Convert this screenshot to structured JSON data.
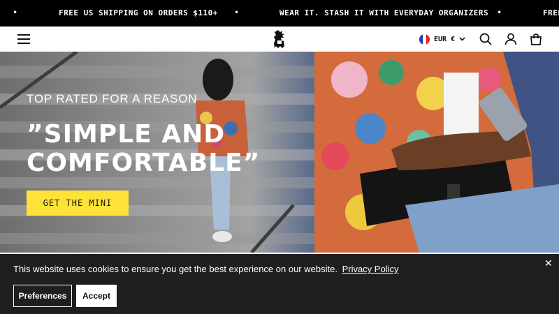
{
  "announcement": {
    "bullet": "•",
    "messages": [
      "FREE US SHIPPING ON ORDERS $110+",
      "WEAR IT. STASH IT WITH EVERYDAY ORGANIZERS",
      "FREE"
    ]
  },
  "header": {
    "menu_icon": "hamburger-menu-icon",
    "logo_icon": "chrome-griffin-logo",
    "currency": {
      "label": "EUR €",
      "flag": "france-flag-icon",
      "chevron": "⌄"
    },
    "icons": [
      "search-icon",
      "account-icon",
      "cart-icon"
    ]
  },
  "hero": {
    "eyebrow": "TOP RATED FOR A REASON",
    "headline_line1": "”SIMPLE AND",
    "headline_line2": "COMFORTABLE”",
    "cta_label": "GET THE MINI",
    "cta_color": "#ffe238"
  },
  "cookie": {
    "text": "This website uses cookies to ensure you get the best experience on our website.",
    "link": "Privacy Policy",
    "close": "✕",
    "preferences_label": "Preferences",
    "accept_label": "Accept"
  }
}
